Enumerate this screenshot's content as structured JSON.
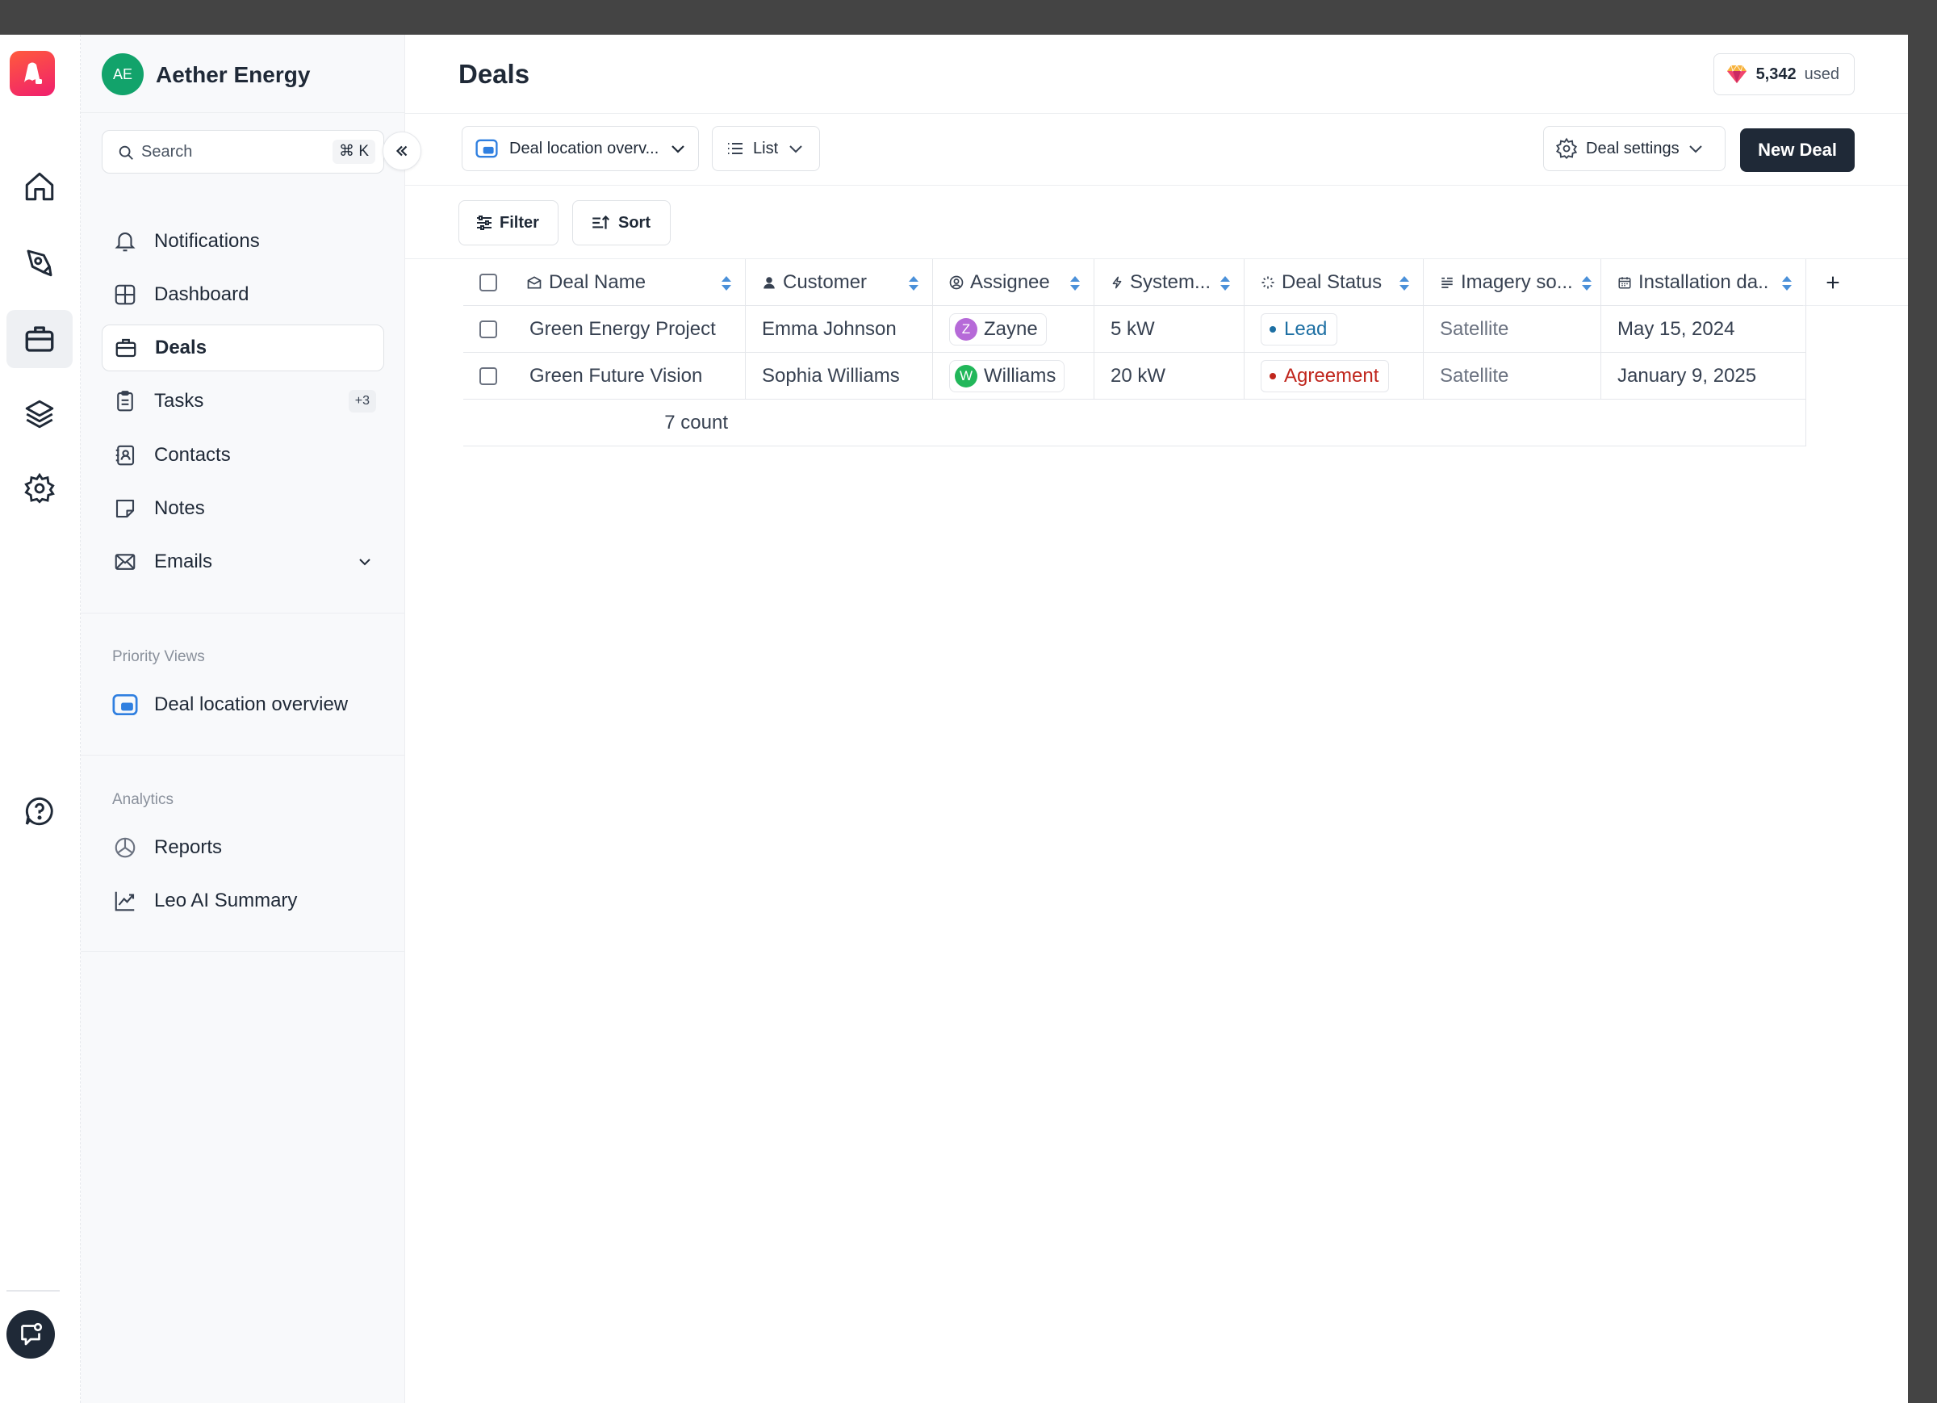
{
  "rail": {
    "items": [
      {
        "icon": "home-icon"
      },
      {
        "icon": "pen-tool-icon"
      },
      {
        "icon": "briefcase-icon",
        "active": true
      },
      {
        "icon": "layers-icon"
      },
      {
        "icon": "settings-gear-icon"
      },
      {
        "icon": "help-chat-icon"
      }
    ]
  },
  "sidebar": {
    "workspace": {
      "initials": "AE",
      "name": "Aether Energy"
    },
    "search": {
      "placeholder": "Search",
      "shortcut": "⌘ K"
    },
    "items": [
      {
        "label": "Notifications",
        "icon": "bell-icon"
      },
      {
        "label": "Dashboard",
        "icon": "dashboard-grid-icon"
      },
      {
        "label": "Deals",
        "icon": "briefcase-icon",
        "active": true
      },
      {
        "label": "Tasks",
        "icon": "clipboard-icon",
        "badge": "+3"
      },
      {
        "label": "Contacts",
        "icon": "contact-book-icon"
      },
      {
        "label": "Notes",
        "icon": "note-icon"
      },
      {
        "label": "Emails",
        "icon": "mail-icon"
      }
    ],
    "priority_views": {
      "title": "Priority Views",
      "items": [
        {
          "label": "Deal location overview",
          "icon": "map-view-icon"
        }
      ]
    },
    "analytics": {
      "title": "Analytics",
      "items": [
        {
          "label": "Reports",
          "icon": "pie-chart-icon"
        },
        {
          "label": "Leo AI Summary",
          "icon": "trend-line-icon"
        }
      ]
    }
  },
  "header": {
    "title": "Deals",
    "credits": {
      "value": "5,342",
      "suffix": "used"
    }
  },
  "toolbar": {
    "view_select": "Deal location overv...",
    "layout_select": "List",
    "settings_label": "Deal settings",
    "new_deal_label": "New Deal",
    "filter_label": "Filter",
    "sort_label": "Sort"
  },
  "table": {
    "columns": [
      "Deal Name",
      "Customer",
      "Assignee",
      "System...",
      "Deal Status",
      "Imagery so...",
      "Installation da.."
    ],
    "rows": [
      {
        "deal_name": "Green Energy Project",
        "customer": "Emma Johnson",
        "assignee": "Zayne",
        "assignee_initial": "Z",
        "assignee_color": "#b66ad8",
        "system": "5 kW",
        "status": "Lead",
        "status_color": "#1d6fa3",
        "imagery": "Satellite",
        "install_date": "May 15, 2024"
      },
      {
        "deal_name": "Green Future Vision",
        "customer": "Sophia Williams",
        "assignee": "Williams",
        "assignee_initial": "W",
        "assignee_color": "#22b75a",
        "system": "20 kW",
        "status": "Agreement",
        "status_color": "#c0261d",
        "imagery": "Satellite",
        "install_date": "January 9, 2025"
      }
    ],
    "footer": "7 count"
  },
  "colors": {
    "accent": "#1f2937",
    "brand": "#f01f6e",
    "sort_arrows": "#4a90d9"
  }
}
